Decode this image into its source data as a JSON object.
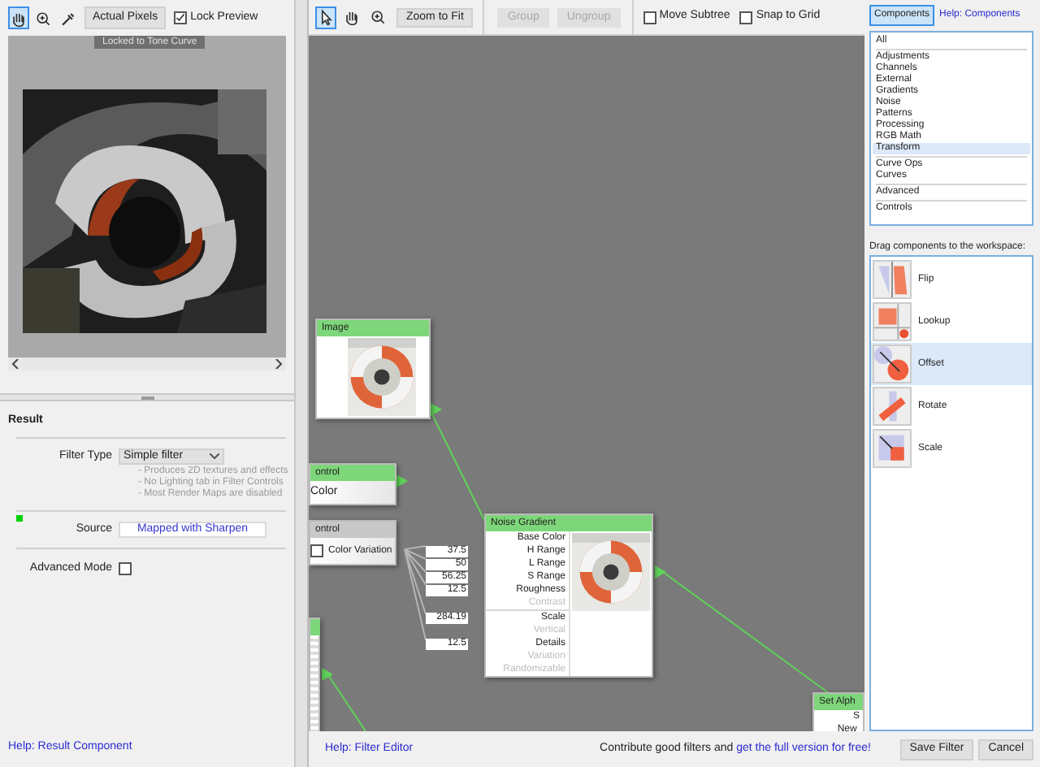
{
  "preview": {
    "tools": [
      {
        "kind": "hand",
        "selected": true
      },
      {
        "kind": "zoom",
        "selected": false
      },
      {
        "kind": "eyedropper",
        "selected": false
      }
    ],
    "actual_pixels_button": "Actual Pixels",
    "lock_preview": {
      "label": "Lock Preview",
      "checked": true
    },
    "overlay_label": "Locked to Tone Curve"
  },
  "result": {
    "title": "Result",
    "filter_type": {
      "label": "Filter Type",
      "value": "Simple filter"
    },
    "notes": [
      "- Produces 2D textures and effects",
      "- No Lighting tab in Filter Controls",
      "- Most Render Maps are disabled"
    ],
    "source": {
      "label": "Source",
      "value": "Mapped with Sharpen",
      "connected": true
    },
    "advanced_mode": {
      "label": "Advanced Mode",
      "checked": false
    },
    "help_link": "Help: Result Component"
  },
  "canvas_toolbar": {
    "tools": [
      {
        "kind": "pointer",
        "selected": true
      },
      {
        "kind": "hand",
        "selected": false
      },
      {
        "kind": "zoom",
        "selected": false
      }
    ],
    "buttons": [
      {
        "label": "Zoom to Fit",
        "disabled": false
      },
      {
        "label": "Group",
        "disabled": true
      },
      {
        "label": "Ungroup",
        "disabled": true
      }
    ],
    "checkboxes": [
      {
        "label": "Move Subtree",
        "checked": false
      },
      {
        "label": "Snap to Grid",
        "checked": false
      }
    ]
  },
  "nodes": [
    {
      "title": "Image",
      "color": "#7ed67a"
    },
    {
      "kind": "control",
      "title": "ontrol",
      "color": "#7ed67a",
      "port": "Color"
    },
    {
      "kind": "checkbox_control",
      "title": "ontrol",
      "color": "#c8c8c8",
      "port": "Color Variation",
      "checked": false
    },
    {
      "kind": "noise",
      "title": "Noise Gradient",
      "color": "#7ed67a",
      "inputs": [
        {
          "label": "Base Color",
          "enabled": true
        },
        {
          "label": "H Range",
          "enabled": true,
          "value": "37.5"
        },
        {
          "label": "L Range",
          "enabled": true,
          "value": "50"
        },
        {
          "label": "S Range",
          "enabled": true,
          "value": "56.25"
        },
        {
          "label": "Roughness",
          "enabled": true,
          "value": "12.5"
        },
        {
          "label": "Contrast",
          "enabled": false
        },
        {
          "label": "Scale",
          "enabled": true,
          "value": "284.19"
        },
        {
          "label": "Vertical",
          "enabled": false
        },
        {
          "label": "Details",
          "enabled": true,
          "value": "12.5"
        },
        {
          "label": "Variation",
          "enabled": false
        },
        {
          "label": "Randomizable",
          "enabled": false
        }
      ]
    },
    {
      "kind": "stub",
      "color": "#7ed67a"
    },
    {
      "kind": "set_alpha",
      "title": "Set Alph",
      "color": "#7ed67a",
      "inputs": [
        "S",
        "New "
      ]
    }
  ],
  "status_bar": {
    "help_link": "Help: Filter Editor",
    "message": "Contribute good filters and ",
    "link": "get the full version for free!"
  },
  "components": {
    "tab": {
      "label": "Components",
      "selected": true
    },
    "help_link": "Help: Components",
    "category_groups": [
      [
        {
          "label": "All",
          "selected": false
        }
      ],
      [
        {
          "label": "Adjustments",
          "selected": false
        },
        {
          "label": "Channels",
          "selected": false
        },
        {
          "label": "External",
          "selected": false
        },
        {
          "label": "Gradients",
          "selected": false
        },
        {
          "label": "Noise",
          "selected": false
        },
        {
          "label": "Patterns",
          "selected": false
        },
        {
          "label": "Processing",
          "selected": false
        },
        {
          "label": "RGB Math",
          "selected": false
        },
        {
          "label": "Transform",
          "selected": true
        }
      ],
      [
        {
          "label": "Curve Ops",
          "selected": false
        },
        {
          "label": "Curves",
          "selected": false
        }
      ],
      [
        {
          "label": "Advanced",
          "selected": false
        }
      ],
      [
        {
          "label": "Controls",
          "selected": false
        }
      ]
    ],
    "drag_hint": "Drag components to the workspace:",
    "items": [
      {
        "kind": "flip",
        "label": "Flip",
        "selected": false
      },
      {
        "kind": "lookup",
        "label": "Lookup",
        "selected": false
      },
      {
        "kind": "offset",
        "label": "Offset",
        "selected": true
      },
      {
        "kind": "rotate",
        "label": "Rotate",
        "selected": false
      },
      {
        "kind": "scale",
        "label": "Scale",
        "selected": false
      }
    ]
  },
  "buttons": [
    {
      "label": "Save Filter"
    },
    {
      "label": "Cancel"
    }
  ]
}
